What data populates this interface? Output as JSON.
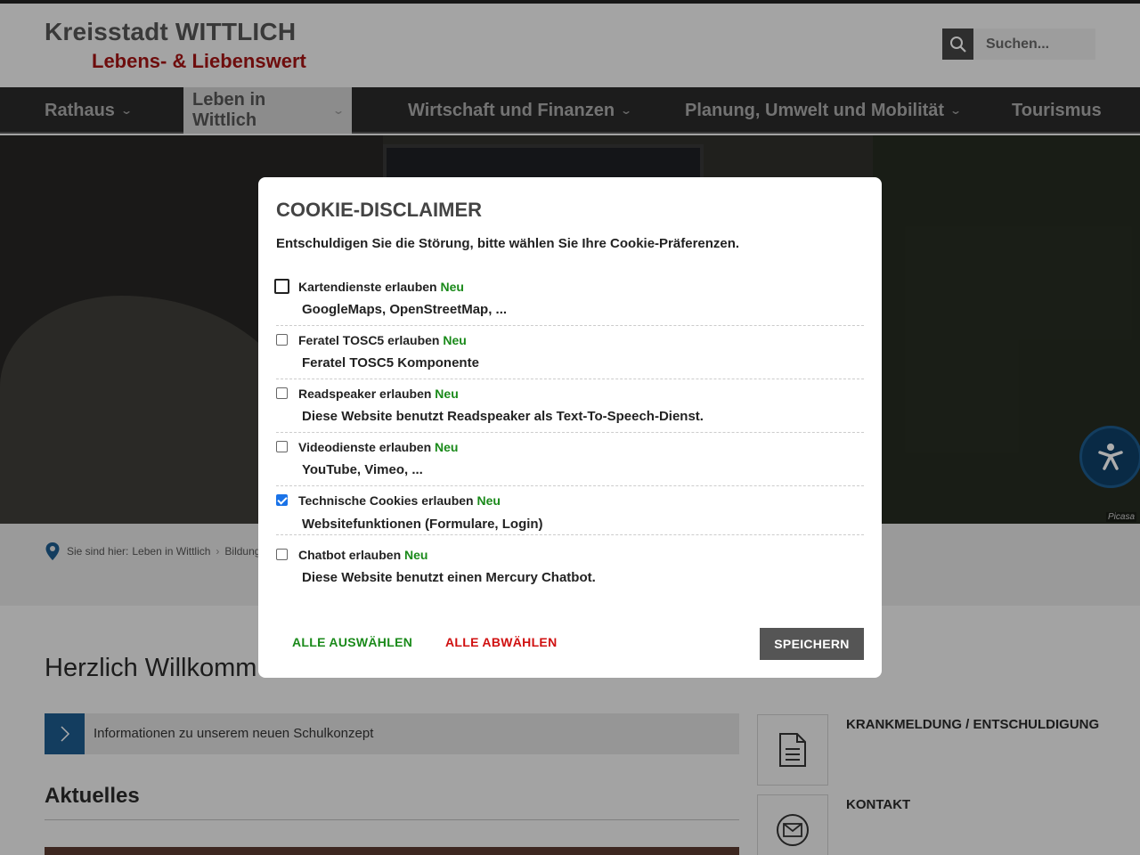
{
  "header": {
    "logo_title": "Kreisstadt WITTLICH",
    "logo_subtitle": "Lebens- & Liebenswert",
    "search_placeholder": "Suchen..."
  },
  "nav": {
    "items": [
      {
        "label": "Rathaus",
        "has_dropdown": true,
        "active": false
      },
      {
        "label": "Leben in Wittlich",
        "has_dropdown": true,
        "active": true
      },
      {
        "label": "Wirtschaft und Finanzen",
        "has_dropdown": true,
        "active": false
      },
      {
        "label": "Planung, Umwelt und Mobilität",
        "has_dropdown": true,
        "active": false
      },
      {
        "label": "Tourismus",
        "has_dropdown": false,
        "active": false
      }
    ]
  },
  "hero": {
    "credit": "Picasa"
  },
  "breadcrumb": {
    "prefix": "Sie sind hier:",
    "items": [
      "Leben in Wittlich",
      "Bildung"
    ]
  },
  "main": {
    "welcome_title": "Herzlich Willkomm",
    "info_link": "Informationen zu unserem neuen Schulkonzept",
    "news_heading": "Aktuelles"
  },
  "sidebar": {
    "items": [
      {
        "label": "KRANKMELDUNG / ENTSCHULDIGUNG",
        "icon": "document-icon"
      },
      {
        "label": "KONTAKT",
        "icon": "envelope-icon"
      }
    ]
  },
  "cookie_modal": {
    "title": "COOKIE-DISCLAIMER",
    "intro": "Entschuldigen Sie die Störung, bitte wählen Sie Ihre Cookie-Präferenzen.",
    "new_badge": "Neu",
    "options": [
      {
        "label": "Kartendienste erlauben",
        "description": "GoogleMaps, OpenStreetMap, ...",
        "checked": false
      },
      {
        "label": "Feratel TOSC5 erlauben",
        "description": "Feratel TOSC5 Komponente",
        "checked": false
      },
      {
        "label": "Readspeaker erlauben",
        "description": "Diese Website benutzt Readspeaker als Text-To-Speech-Dienst.",
        "checked": false
      },
      {
        "label": "Videodienste erlauben",
        "description": "YouTube, Vimeo, ...",
        "checked": false
      },
      {
        "label": "Technische Cookies erlauben",
        "description": "Websitefunktionen (Formulare, Login)",
        "checked": true
      },
      {
        "label": "Chatbot erlauben",
        "description": "Diese Website benutzt einen Mercury Chatbot.",
        "checked": false
      }
    ],
    "select_all_label": "ALLE AUSWÄHLEN",
    "deselect_all_label": "ALLE ABWÄHLEN",
    "save_label": "SPEICHERN"
  },
  "colors": {
    "brand_red": "#a31414",
    "accent_blue": "#1d5a8c",
    "new_green": "#1a8a1a",
    "deselect_red": "#d01010"
  }
}
